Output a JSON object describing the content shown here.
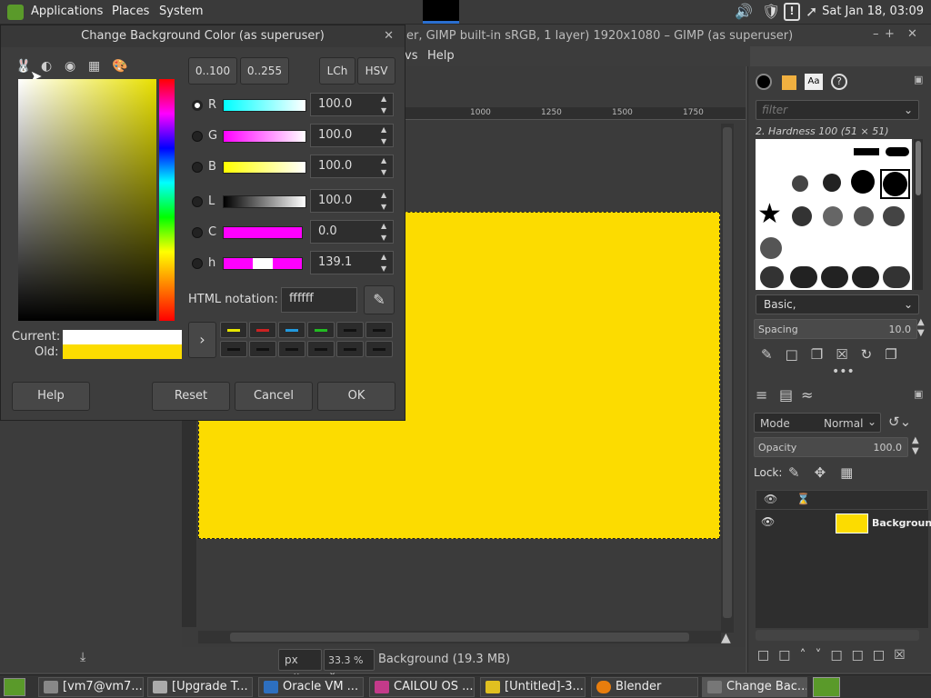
{
  "top_panel": {
    "applications": "Applications",
    "places": "Places",
    "system": "System",
    "clock": "Sat Jan 18, 03:09"
  },
  "gimp": {
    "title": "er, GIMP built-in sRGB, 1 layer) 1920x1080 – GIMP (as superuser)",
    "menu": {
      "windows_partial": "vs",
      "help": "Help"
    },
    "ruler": [
      "1000",
      "1250",
      "1500",
      "1750"
    ],
    "status": {
      "unit": "px",
      "zoom": "33.3 %",
      "info": "Background (19.3 MB)"
    },
    "image_color": "#fcdc00"
  },
  "dock": {
    "filter_placeholder": "filter",
    "brush_name": "2. Hardness 100 (51 × 51)",
    "preset": "Basic,",
    "spacing_label": "Spacing",
    "spacing_value": "10.0",
    "mode_label": "Mode",
    "mode_value": "Normal",
    "opacity_label": "Opacity",
    "opacity_value": "100.0",
    "lock_label": "Lock:",
    "layer_name": "Backgroun"
  },
  "dialog": {
    "title": "Change Background Color (as superuser)",
    "range_buttons": [
      "0..100",
      "0..255"
    ],
    "model_buttons": [
      "LCh",
      "HSV"
    ],
    "channels": [
      {
        "label": "R",
        "value": "100.0",
        "selected": true
      },
      {
        "label": "G",
        "value": "100.0",
        "selected": false
      },
      {
        "label": "B",
        "value": "100.0",
        "selected": false
      },
      {
        "label": "L",
        "value": "100.0",
        "selected": false
      },
      {
        "label": "C",
        "value": "0.0",
        "selected": false
      },
      {
        "label": "h",
        "value": "139.1",
        "selected": false
      }
    ],
    "html_label": "HTML notation:",
    "html_value": "ffffff",
    "current_label": "Current:",
    "old_label": "Old:",
    "current_color": "#ffffff",
    "old_color": "#fcdc00",
    "history_colors": [
      "#e6e600",
      "#cc2222",
      "#2299dd",
      "#22bb22"
    ],
    "buttons": {
      "help": "Help",
      "reset": "Reset",
      "cancel": "Cancel",
      "ok": "OK"
    }
  },
  "taskbar": [
    {
      "label": "[vm7@vm7..."
    },
    {
      "label": "[Upgrade T..."
    },
    {
      "label": "Oracle VM ..."
    },
    {
      "label": "CAILOU OS ..."
    },
    {
      "label": "[Untitled]-3...."
    },
    {
      "label": "Blender"
    },
    {
      "label": "Change Bac..."
    }
  ]
}
